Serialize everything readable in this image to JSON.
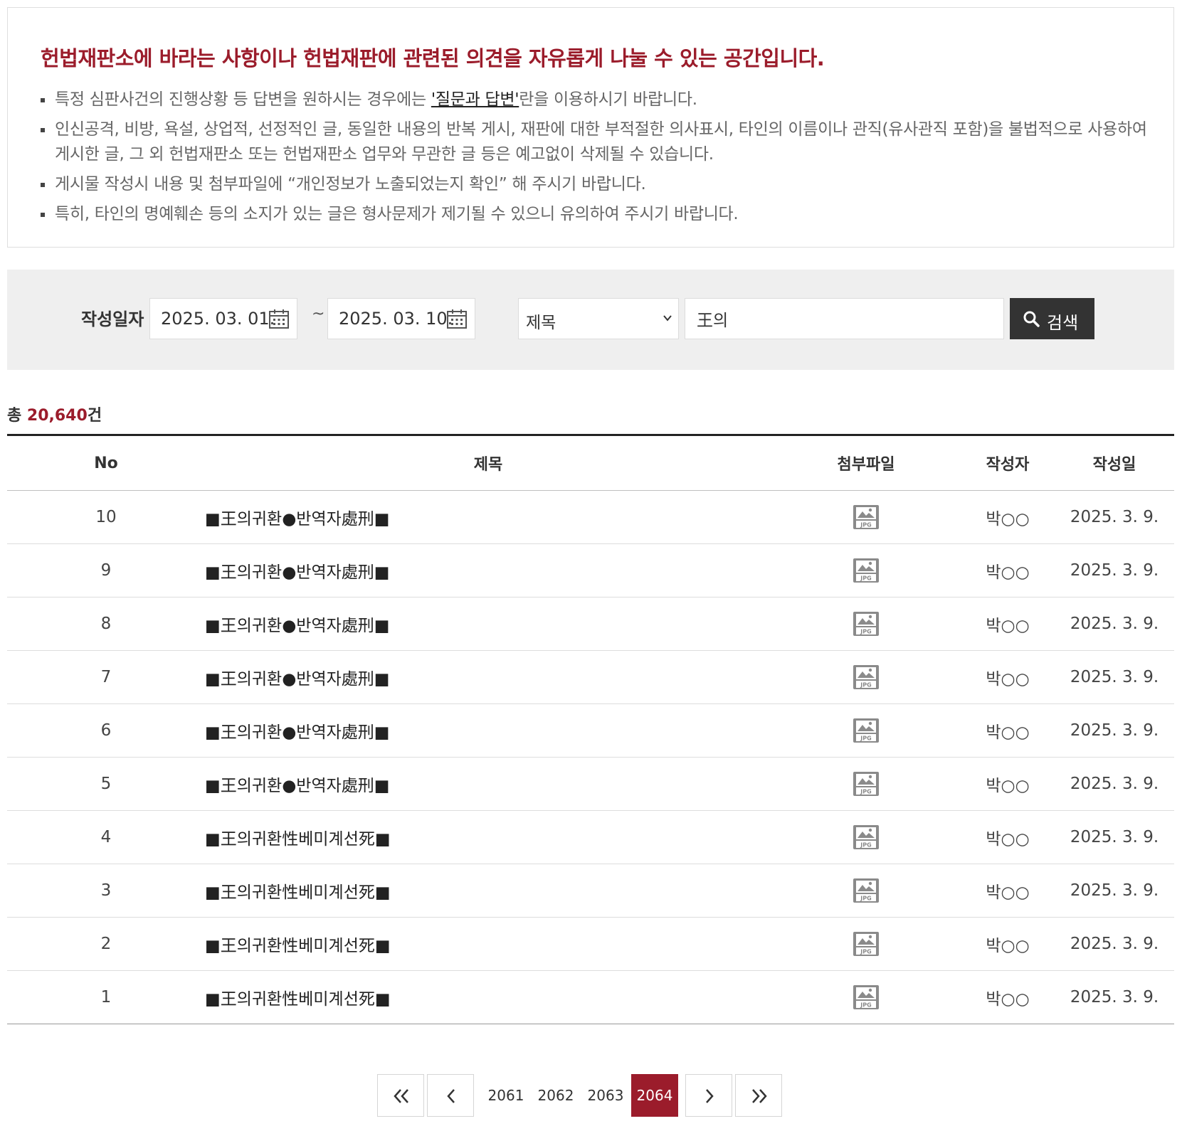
{
  "notice": {
    "title": "헌법재판소에 바라는 사항이나 헌법재판에 관련된 의견을 자유롭게 나눌 수 있는 공간입니다.",
    "item1_before": "특정 심판사건의 진행상황 등 답변을 원하시는 경우에는 ",
    "item1_link": "'질문과 답변'",
    "item1_after": "란을 이용하시기 바랍니다.",
    "item2": "인신공격, 비방, 욕설, 상업적, 선정적인 글, 동일한 내용의 반복 게시, 재판에 대한 부적절한 의사표시, 타인의 이름이나 관직(유사관직 포함)을 불법적으로 사용하여 게시한 글, 그 외 헌법재판소 또는 헌법재판소 업무와 무관한 글 등은 예고없이 삭제될 수 있습니다.",
    "item3": "게시물 작성시 내용 및 첨부파일에 “개인정보가 노출되었는지 확인” 해 주시기 바랍니다.",
    "item4": "특히, 타인의 명예훼손 등의 소지가 있는 글은 형사문제가 제기될 수 있으니 유의하여 주시기 바랍니다."
  },
  "search": {
    "date_label": "작성일자",
    "date_from": "2025. 03. 01.",
    "date_to": "2025. 03. 10.",
    "tilde": "~",
    "field_selected": "제목",
    "keyword": "王의",
    "button_label": "검색"
  },
  "total": {
    "prefix": "총 ",
    "count": "20,640",
    "suffix": "건"
  },
  "table": {
    "headers": {
      "no": "No",
      "title": "제목",
      "attachment": "첨부파일",
      "author": "작성자",
      "date": "작성일"
    },
    "rows": [
      {
        "no": "10",
        "title": "■王의귀환●반역자處刑■",
        "attachment": "jpg-icon",
        "author": "박○○",
        "date": "2025. 3. 9."
      },
      {
        "no": "9",
        "title": "■王의귀환●반역자處刑■",
        "attachment": "jpg-icon",
        "author": "박○○",
        "date": "2025. 3. 9."
      },
      {
        "no": "8",
        "title": "■王의귀환●반역자處刑■",
        "attachment": "jpg-icon",
        "author": "박○○",
        "date": "2025. 3. 9."
      },
      {
        "no": "7",
        "title": "■王의귀환●반역자處刑■",
        "attachment": "jpg-icon",
        "author": "박○○",
        "date": "2025. 3. 9."
      },
      {
        "no": "6",
        "title": "■王의귀환●반역자處刑■",
        "attachment": "jpg-icon",
        "author": "박○○",
        "date": "2025. 3. 9."
      },
      {
        "no": "5",
        "title": "■王의귀환●반역자處刑■",
        "attachment": "jpg-icon",
        "author": "박○○",
        "date": "2025. 3. 9."
      },
      {
        "no": "4",
        "title": "■王의귀환性베미계선死■",
        "attachment": "jpg-icon",
        "author": "박○○",
        "date": "2025. 3. 9."
      },
      {
        "no": "3",
        "title": "■王의귀환性베미계선死■",
        "attachment": "jpg-icon",
        "author": "박○○",
        "date": "2025. 3. 9."
      },
      {
        "no": "2",
        "title": "■王의귀환性베미계선死■",
        "attachment": "jpg-icon",
        "author": "박○○",
        "date": "2025. 3. 9."
      },
      {
        "no": "1",
        "title": "■王의귀환性베미계선死■",
        "attachment": "jpg-icon",
        "author": "박○○",
        "date": "2025. 3. 9."
      }
    ]
  },
  "pagination": {
    "pages": [
      "2061",
      "2062",
      "2063",
      "2064"
    ],
    "current": "2064"
  },
  "colors": {
    "accent": "#9b1c2b",
    "search_button": "#333333",
    "search_panel": "#efefef"
  }
}
